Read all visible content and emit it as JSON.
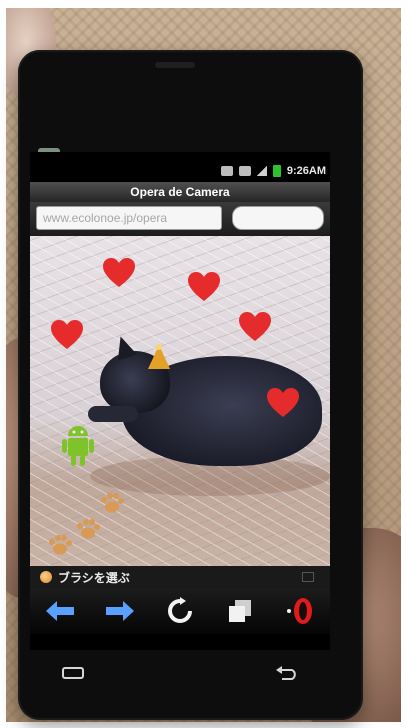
{
  "statusbar": {
    "time": "9:26AM"
  },
  "browser": {
    "title": "Opera de Camera",
    "url": "www.ecolonoe.jp/opera"
  },
  "menu": {
    "label": "ブラシを選ぶ"
  },
  "colors": {
    "heart": "#e52b2b",
    "droid": "#7fc32b",
    "paw": "#d89a55",
    "nav_arrow": "#5aa0ff",
    "opera_red": "#e11a1a"
  },
  "icons": {
    "back": "arrow-left-icon",
    "forward": "arrow-right-icon",
    "reload": "reload-icon",
    "tabs": "tabs-icon",
    "opera": "opera-logo-icon"
  }
}
